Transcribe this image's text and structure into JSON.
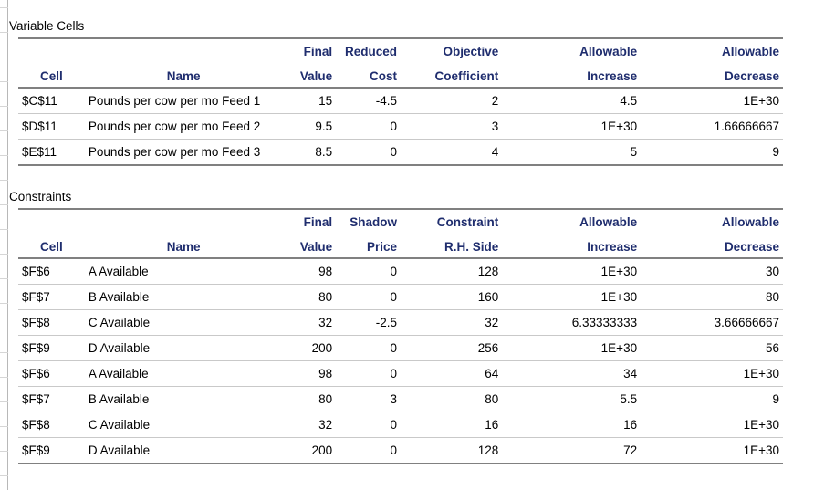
{
  "report": {
    "sections": [
      {
        "id": "variable-cells",
        "title": "Variable Cells",
        "headers": {
          "cell": "Cell",
          "name": "Name",
          "col3_line1": "Final",
          "col3_line2": "Value",
          "col4_line1": "Reduced",
          "col4_line2": "Cost",
          "col5_line1": "Objective",
          "col5_line2": "Coefficient",
          "col6_line1": "Allowable",
          "col6_line2": "Increase",
          "col7_line1": "Allowable",
          "col7_line2": "Decrease"
        },
        "rows": [
          {
            "cell": "$C$11",
            "name": "Pounds per cow per mo Feed 1",
            "final_value": "15",
            "reduced_cost": "-4.5",
            "objective_coefficient": "2",
            "allowable_increase": "4.5",
            "allowable_decrease": "1E+30"
          },
          {
            "cell": "$D$11",
            "name": "Pounds per cow per mo Feed 2",
            "final_value": "9.5",
            "reduced_cost": "0",
            "objective_coefficient": "3",
            "allowable_increase": "1E+30",
            "allowable_decrease": "1.66666667"
          },
          {
            "cell": "$E$11",
            "name": "Pounds per cow per mo Feed 3",
            "final_value": "8.5",
            "reduced_cost": "0",
            "objective_coefficient": "4",
            "allowable_increase": "5",
            "allowable_decrease": "9"
          }
        ]
      },
      {
        "id": "constraints",
        "title": "Constraints",
        "headers": {
          "cell": "Cell",
          "name": "Name",
          "col3_line1": "Final",
          "col3_line2": "Value",
          "col4_line1": "Shadow",
          "col4_line2": "Price",
          "col5_line1": "Constraint",
          "col5_line2": "R.H. Side",
          "col6_line1": "Allowable",
          "col6_line2": "Increase",
          "col7_line1": "Allowable",
          "col7_line2": "Decrease"
        },
        "rows": [
          {
            "cell": "$F$6",
            "name": "A Available",
            "final_value": "98",
            "shadow_price": "0",
            "constraint_rh_side": "128",
            "allowable_increase": "1E+30",
            "allowable_decrease": "30"
          },
          {
            "cell": "$F$7",
            "name": "B Available",
            "final_value": "80",
            "shadow_price": "0",
            "constraint_rh_side": "160",
            "allowable_increase": "1E+30",
            "allowable_decrease": "80"
          },
          {
            "cell": "$F$8",
            "name": "C Available",
            "final_value": "32",
            "shadow_price": "-2.5",
            "constraint_rh_side": "32",
            "allowable_increase": "6.33333333",
            "allowable_decrease": "3.66666667"
          },
          {
            "cell": "$F$9",
            "name": "D Available",
            "final_value": "200",
            "shadow_price": "0",
            "constraint_rh_side": "256",
            "allowable_increase": "1E+30",
            "allowable_decrease": "56"
          },
          {
            "cell": "$F$6",
            "name": "A Available",
            "final_value": "98",
            "shadow_price": "0",
            "constraint_rh_side": "64",
            "allowable_increase": "34",
            "allowable_decrease": "1E+30"
          },
          {
            "cell": "$F$7",
            "name": "B Available",
            "final_value": "80",
            "shadow_price": "3",
            "constraint_rh_side": "80",
            "allowable_increase": "5.5",
            "allowable_decrease": "9"
          },
          {
            "cell": "$F$8",
            "name": "C Available",
            "final_value": "32",
            "shadow_price": "0",
            "constraint_rh_side": "16",
            "allowable_increase": "16",
            "allowable_decrease": "1E+30"
          },
          {
            "cell": "$F$9",
            "name": "D Available",
            "final_value": "200",
            "shadow_price": "0",
            "constraint_rh_side": "128",
            "allowable_increase": "72",
            "allowable_decrease": "1E+30"
          }
        ]
      }
    ],
    "colors": {
      "header_text": "#1F2D6E",
      "body_text": "#000000",
      "heavy_rule": "#808080",
      "light_rule": "#c9c9c9",
      "gridline": "#d6d6d6",
      "background": "#ffffff"
    }
  }
}
